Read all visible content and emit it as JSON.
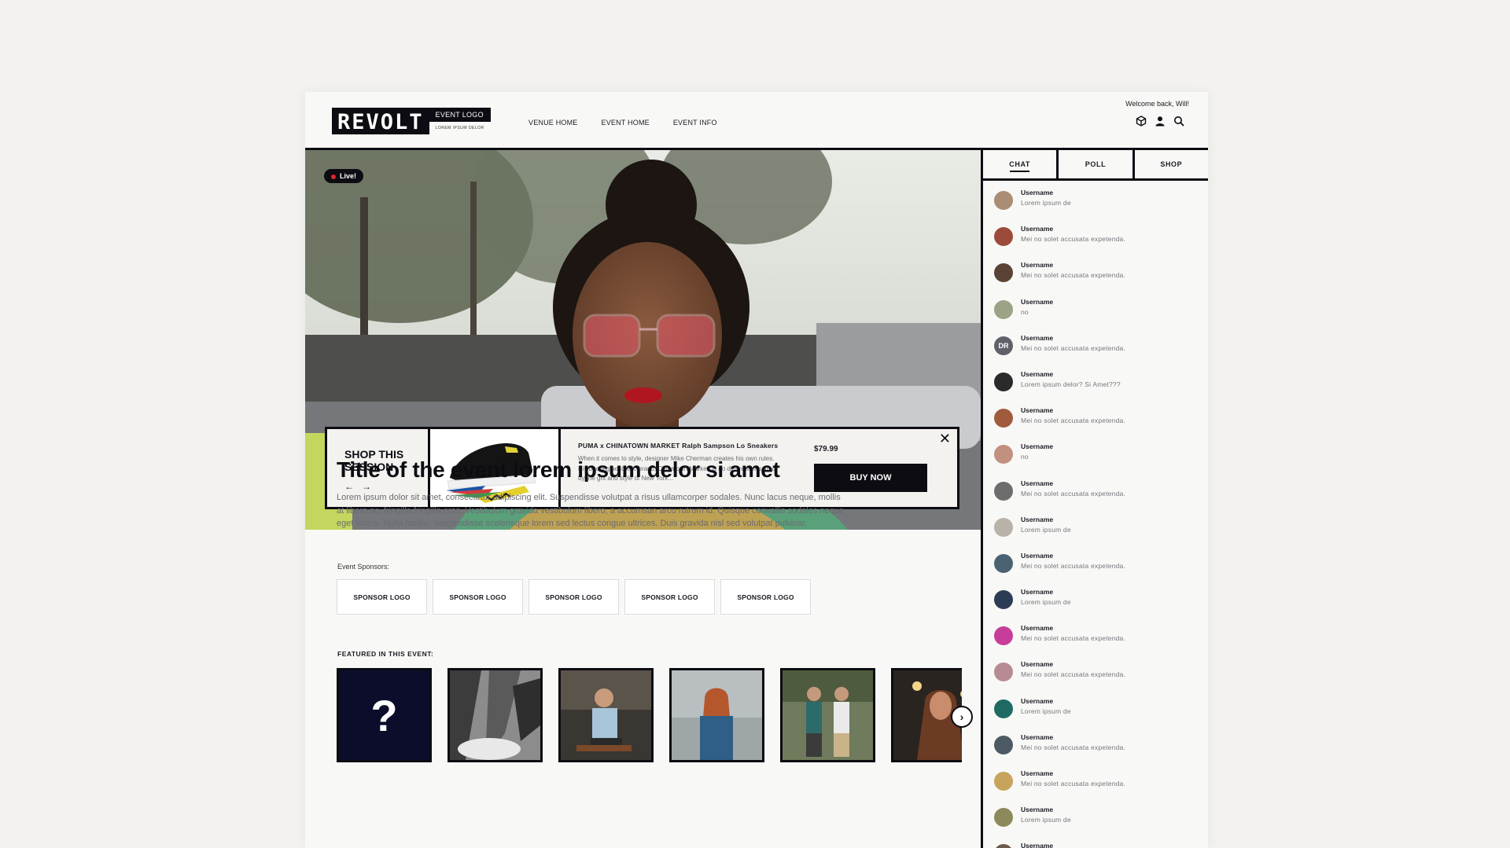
{
  "header": {
    "logo_main": "REVOLT",
    "logo_event": "EVENT LOGO",
    "logo_sub": "LOREM IPSUM DELOR",
    "nav": [
      "VENUE HOME",
      "EVENT HOME",
      "EVENT INFO"
    ],
    "welcome": "Welcome back, Will!",
    "icons": [
      "cube-icon",
      "user-icon",
      "search-icon"
    ]
  },
  "hero": {
    "live_label": "Live!"
  },
  "shop": {
    "title": "SHOP THIS SESSION",
    "prev": "←",
    "next": "→",
    "product_name": "PUMA x CHINATOWN MARKET Ralph Sampson Lo Sneakers",
    "product_desc": "When it comes to style, designer Mike Cherman creates his own rules. His bootleg aesthetic brand, Chinatown Market, is no different. Inspired by the grit and style of New York...",
    "price": "$79.99",
    "buy_label": "BUY NOW",
    "close": "✕"
  },
  "event": {
    "title": "Title of the event lorem ipsum delor si amet",
    "description": "Lorem ipsum dolor sit amet, consectetur adipiscing elit. Suspendisse volutpat a risus ullamcorper sodales. Nunc lacus neque, mollis at libero ac, fringilla fringilla eros. Vestibulum gravida vestibulum libero, a accumsan arcu rutrum id. Quisque convallis sodales neque eget luctus. Nulla facilisi. Suspendisse scelerisque lorem sed lectus congue ultrices. Duis gravida nisl sed volutpat pulvinar.",
    "sponsors_label": "Event Sponsors:",
    "sponsors": [
      "SPONSOR LOGO",
      "SPONSOR LOGO",
      "SPONSOR LOGO",
      "SPONSOR LOGO",
      "SPONSOR LOGO"
    ],
    "featured_label": "FEATURED IN THIS EVENT:",
    "featured_first": "?",
    "featured_next": "›"
  },
  "sidebar": {
    "tabs": [
      "CHAT",
      "POLL",
      "SHOP"
    ],
    "messages": [
      {
        "user": "Username",
        "text": "Lorem ipsum de",
        "color": "#a98d74"
      },
      {
        "user": "Username",
        "text": "Mei no solet accusata expetenda.",
        "color": "#9c4b3b"
      },
      {
        "user": "Username",
        "text": "Mei no solet accusata expetenda.",
        "color": "#5a4334"
      },
      {
        "user": "Username",
        "text": "no",
        "color": "#9aa385"
      },
      {
        "user": "Username",
        "text": "Mei no solet accusata expetenda.",
        "color": "#5f6169",
        "initials": "DR"
      },
      {
        "user": "Username",
        "text": "Lorem ipsum delor? Si Amet???",
        "color": "#2a2a2a"
      },
      {
        "user": "Username",
        "text": "Mei no solet accusata expetenda.",
        "color": "#a05a3e"
      },
      {
        "user": "Username",
        "text": "no",
        "color": "#c29080"
      },
      {
        "user": "Username",
        "text": "Mei no solet accusata expetenda.",
        "color": "#6d6d6d"
      },
      {
        "user": "Username",
        "text": "Lorem ipsum de",
        "color": "#b9b2a8"
      },
      {
        "user": "Username",
        "text": "Mei no solet accusata expetenda.",
        "color": "#4b6272"
      },
      {
        "user": "Username",
        "text": "Lorem ipsum de",
        "color": "#2d3c55"
      },
      {
        "user": "Username",
        "text": "Mei no solet accusata expetenda.",
        "color": "#c73e9a"
      },
      {
        "user": "Username",
        "text": "Mei no solet accusata expetenda.",
        "color": "#b88a93"
      },
      {
        "user": "Username",
        "text": "Lorem ipsum de",
        "color": "#1f6b63"
      },
      {
        "user": "Username",
        "text": "Mei no solet accusata expetenda.",
        "color": "#4e5a63"
      },
      {
        "user": "Username",
        "text": "Mei no solet accusata expetenda.",
        "color": "#c7a35c"
      },
      {
        "user": "Username",
        "text": "Lorem ipsum de",
        "color": "#8c8a5a"
      },
      {
        "user": "Username",
        "text": "",
        "color": "#6f5a4a"
      }
    ]
  }
}
